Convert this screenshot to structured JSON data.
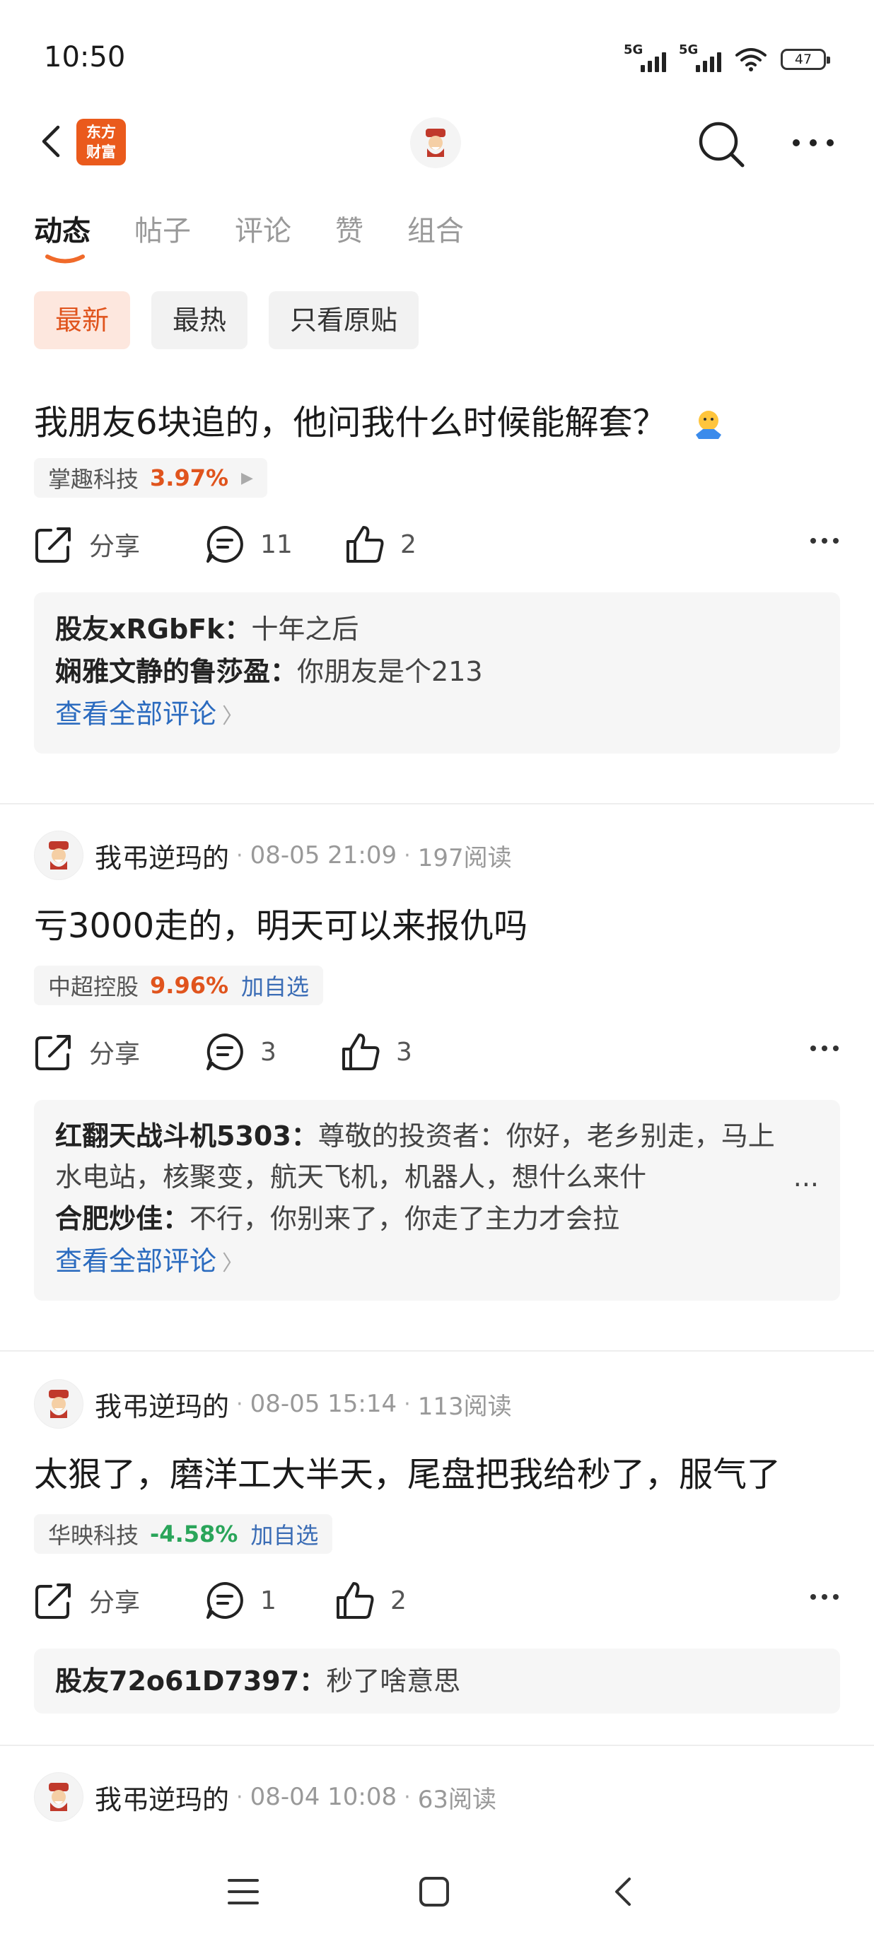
{
  "status": {
    "time": "10:50",
    "sig1": "5G",
    "sig2": "5G",
    "battery": "47"
  },
  "header": {
    "logo_line1": "东方",
    "logo_line2": "财富"
  },
  "tabs": [
    "动态",
    "帖子",
    "评论",
    "赞",
    "组合"
  ],
  "filters": [
    "最新",
    "最热",
    "只看原贴"
  ],
  "posts": [
    {
      "text": "我朋友6块追的，他问我什么时候能解套？",
      "stock": {
        "name": "掌趣科技",
        "change": "3.97%"
      },
      "share": "分享",
      "comments": "11",
      "likes": "2",
      "replies": [
        {
          "user": "股友xRGbFk：",
          "text": "十年之后"
        },
        {
          "user": "娴雅文静的鲁莎盈：",
          "text": "你朋友是个213"
        }
      ],
      "view_all": "查看全部评论"
    },
    {
      "user": "我弔逆玛的",
      "date": "08-05 21:09",
      "reads": "197阅读",
      "text": "亏3000走的，明天可以来报仇吗",
      "stock": {
        "name": "中超控股",
        "change": "9.96%",
        "add": "加自选"
      },
      "share": "分享",
      "comments": "3",
      "likes": "3",
      "replies": [
        {
          "user": "红翻天战斗机5303：",
          "text": "尊敬的投资者：你好，老乡别走，马上水电站，核聚变，航天飞机，机器人，想什么来什",
          "ellipsis": "..."
        },
        {
          "user": "合肥炒佳：",
          "text": "不行，你别来了，你走了主力才会拉"
        }
      ],
      "view_all": "查看全部评论"
    },
    {
      "user": "我弔逆玛的",
      "date": "08-05 15:14",
      "reads": "113阅读",
      "text": "太狠了，磨洋工大半天，尾盘把我给秒了，服气了",
      "stock": {
        "name": "华映科技",
        "change": "-4.58%",
        "add": "加自选"
      },
      "share": "分享",
      "comments": "1",
      "likes": "2",
      "replies": [
        {
          "user": "股友72o61D7397：",
          "text": "秒了啥意思"
        }
      ]
    },
    {
      "user": "我弔逆玛的",
      "date": "08-04 10:08",
      "reads": "63阅读"
    }
  ]
}
